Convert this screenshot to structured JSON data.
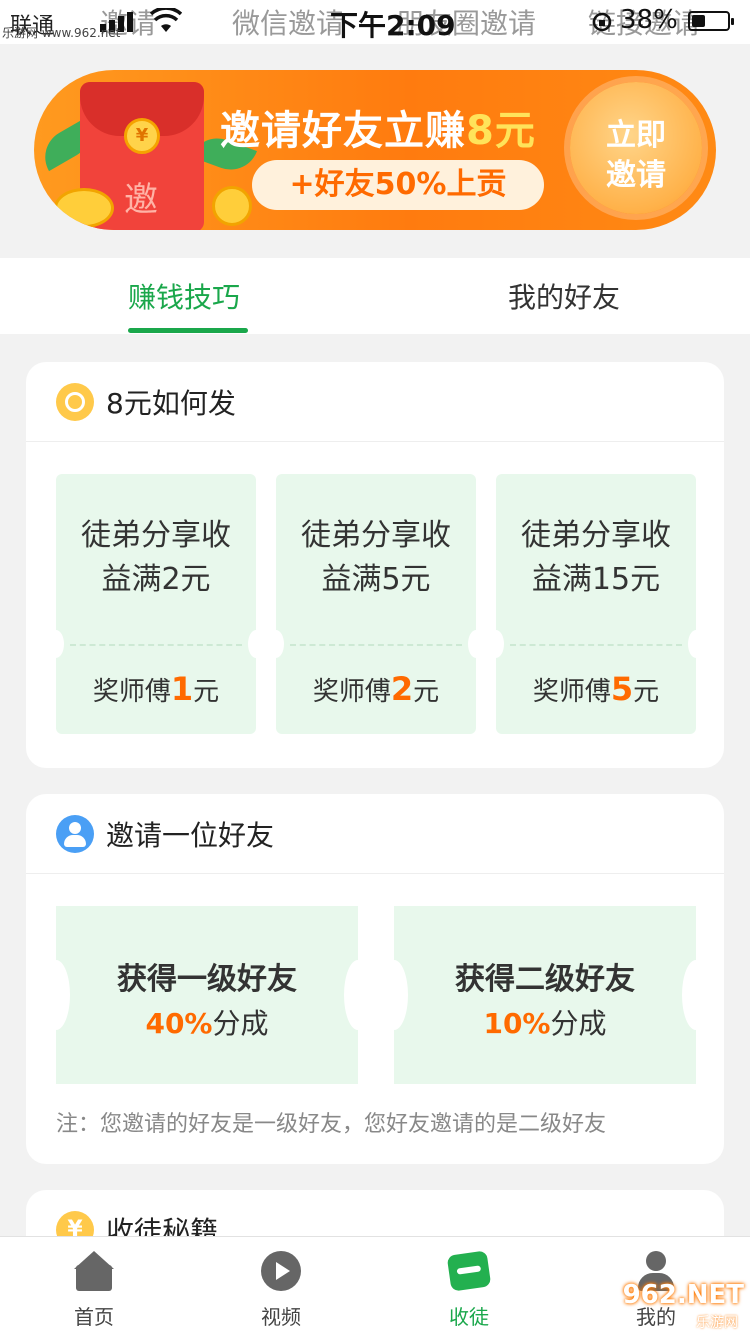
{
  "invite_tabs": [
    "邀请",
    "微信邀请",
    "朋友圈邀请",
    "链接邀请"
  ],
  "status_bar": {
    "carrier": "联通",
    "time": "下午2:09",
    "battery_percent": "38%",
    "battery_level": 0.38
  },
  "watermark_top": "乐游网 www.962.net",
  "banner": {
    "title_prefix": "邀请好友立赚",
    "title_amount": "8元",
    "subtitle": "+好友50%上贡",
    "button_line1": "立即",
    "button_line2": "邀请",
    "envelope_char": "邀",
    "coin_symbol": "¥"
  },
  "tabs": [
    {
      "label": "赚钱技巧",
      "active": true
    },
    {
      "label": "我的好友",
      "active": false
    }
  ],
  "card_payout": {
    "title": "8元如何发",
    "tickets": [
      {
        "line1": "徒弟分享收",
        "line2": "益满2元",
        "reward_prefix": "奖师傅",
        "reward_num": "1",
        "reward_unit": "元"
      },
      {
        "line1": "徒弟分享收",
        "line2": "益满5元",
        "reward_prefix": "奖师傅",
        "reward_num": "2",
        "reward_unit": "元"
      },
      {
        "line1": "徒弟分享收",
        "line2": "益满15元",
        "reward_prefix": "奖师傅",
        "reward_num": "5",
        "reward_unit": "元"
      }
    ]
  },
  "card_invite": {
    "title": "邀请一位好友",
    "tickets": [
      {
        "title": "获得一级好友",
        "pct": "40%",
        "suffix": "分成"
      },
      {
        "title": "获得二级好友",
        "pct": "10%",
        "suffix": "分成"
      }
    ],
    "note": "注：您邀请的好友是一级好友，您好友邀请的是二级好友"
  },
  "card_secret": {
    "title": "收徒秘籍"
  },
  "bottom_nav": [
    {
      "label": "首页",
      "icon": "home-icon",
      "active": false
    },
    {
      "label": "视频",
      "icon": "video-icon",
      "active": false
    },
    {
      "label": "收徒",
      "icon": "apprentice-icon",
      "active": true
    },
    {
      "label": "我的",
      "icon": "profile-icon",
      "active": false
    }
  ],
  "watermark_bottom": "962.NET",
  "watermark_bottom_sub": "乐游网",
  "colors": {
    "accent_green": "#1aa74b",
    "accent_orange": "#ff6a00",
    "ticket_bg": "#e8f8ec"
  }
}
